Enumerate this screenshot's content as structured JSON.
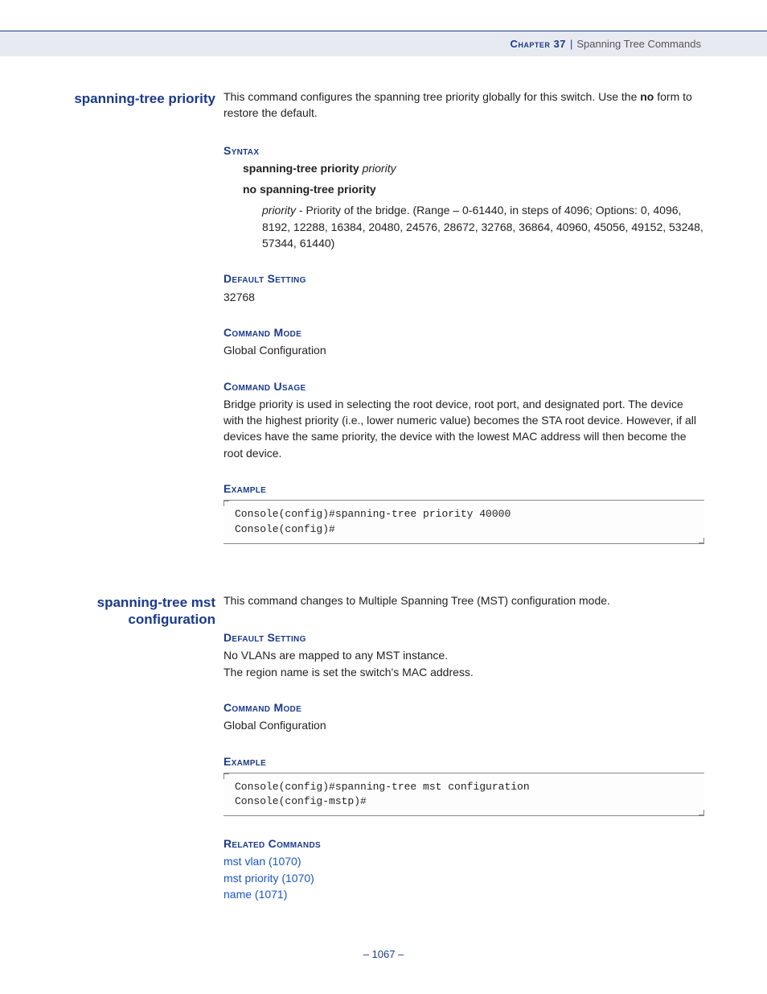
{
  "header": {
    "chapter": "Chapter 37",
    "pipe": "|",
    "title": "Spanning Tree Commands"
  },
  "sections": [
    {
      "margin_title": "spanning-tree priority",
      "intro_html": "This command configures the spanning tree priority globally for this switch. Use the <b>no</b> form to restore the default.",
      "blocks": [
        {
          "heading": "Syntax",
          "type": "syntax",
          "lines": [
            "<b>spanning-tree priority</b> <i>priority</i>",
            "<b>no spanning-tree priority</b>"
          ],
          "param": "<i>priority</i> - Priority of the bridge. (Range – 0-61440, in steps of 4096; Options: 0, 4096, 8192, 12288, 16384, 20480, 24576, 28672, 32768, 36864, 40960, 45056, 49152, 53248, 57344, 61440)"
        },
        {
          "heading": "Default Setting",
          "type": "text",
          "text": "32768"
        },
        {
          "heading": "Command Mode",
          "type": "text",
          "text": "Global Configuration"
        },
        {
          "heading": "Command Usage",
          "type": "text",
          "text": "Bridge priority is used in selecting the root device, root port, and designated port. The device with the highest priority (i.e., lower numeric value) becomes the STA root device. However, if all devices have the same priority, the device with the lowest MAC address will then become the root device."
        },
        {
          "heading": "Example",
          "type": "code",
          "code": "Console(config)#spanning-tree priority 40000\nConsole(config)#"
        }
      ]
    },
    {
      "margin_title": "spanning-tree mst configuration",
      "intro_html": "This command changes to Multiple Spanning Tree (MST) configuration mode.",
      "blocks": [
        {
          "heading": "Default Setting",
          "type": "text",
          "text": "No VLANs are mapped to any MST instance.\nThe region name is set the switch's MAC address."
        },
        {
          "heading": "Command Mode",
          "type": "text",
          "text": "Global Configuration"
        },
        {
          "heading": "Example",
          "type": "code",
          "code": "Console(config)#spanning-tree mst configuration\nConsole(config-mstp)#"
        },
        {
          "heading": "Related Commands",
          "type": "links",
          "links": [
            "mst vlan (1070)",
            "mst priority (1070)",
            "name (1071)"
          ]
        }
      ]
    }
  ],
  "page_number": "–  1067  –"
}
